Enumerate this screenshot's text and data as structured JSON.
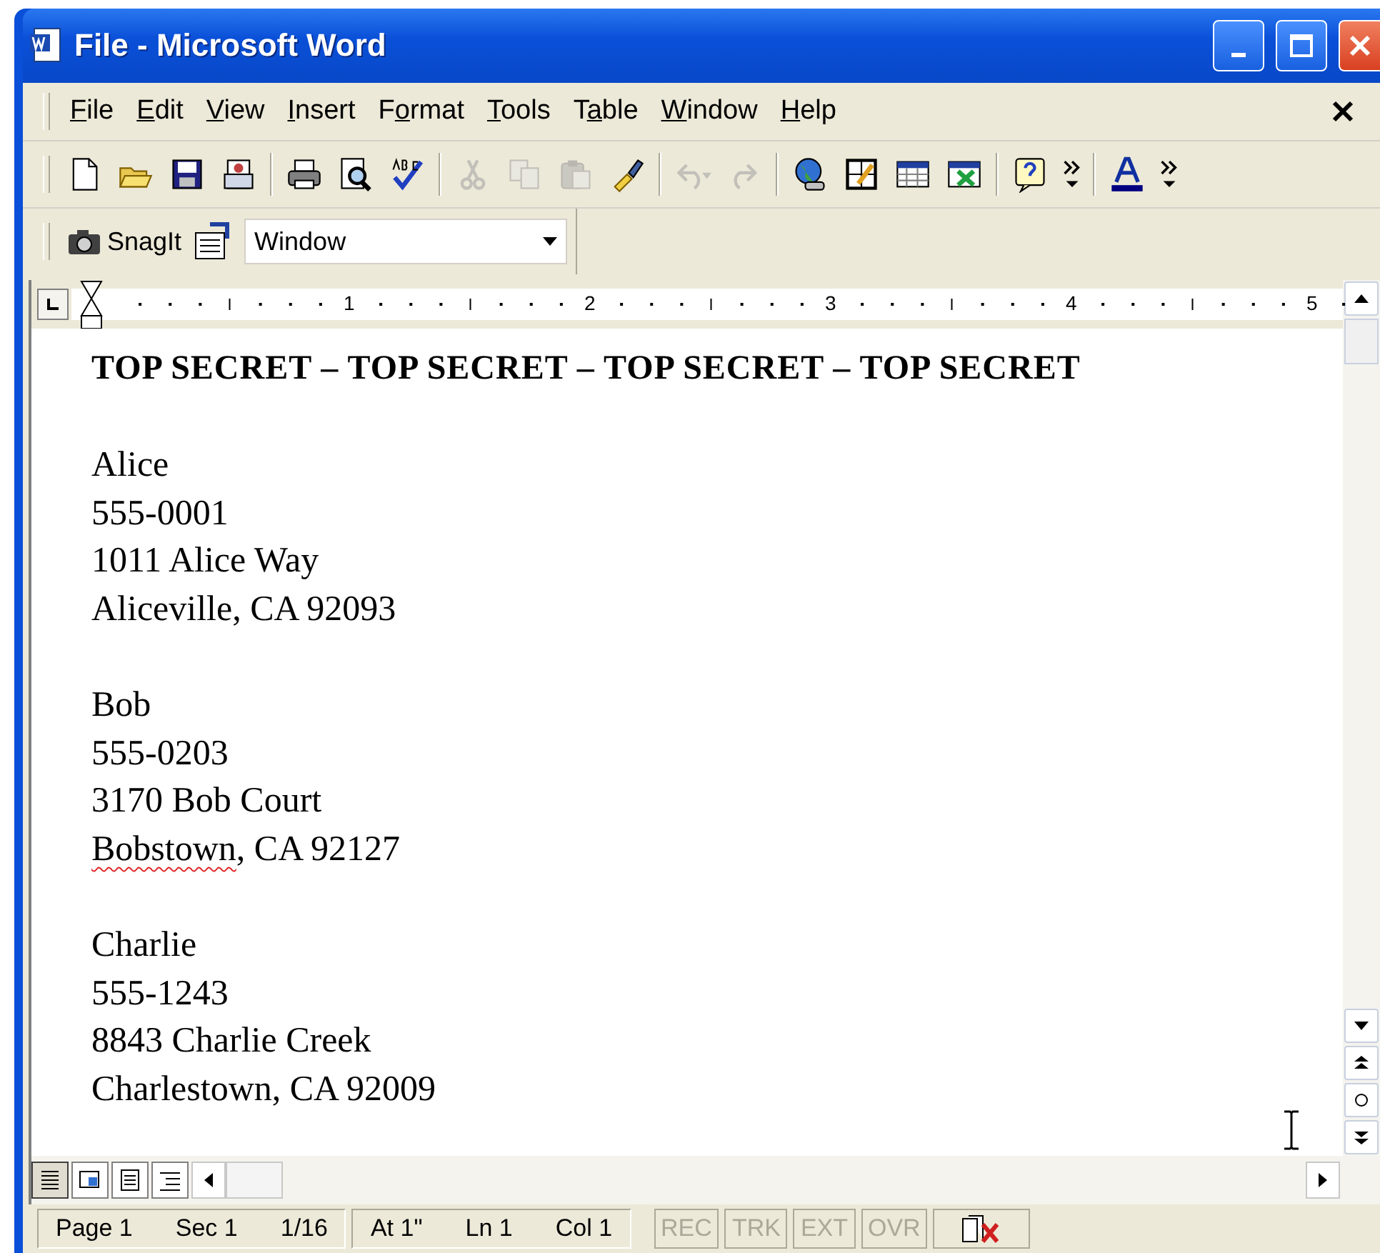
{
  "window": {
    "title": "File - Microsoft Word"
  },
  "menu": [
    {
      "key": "F",
      "rest": "ile"
    },
    {
      "key": "E",
      "rest": "dit"
    },
    {
      "key": "V",
      "rest": "iew"
    },
    {
      "key": "I",
      "rest": "nsert"
    },
    {
      "pre": "F",
      "key": "o",
      "rest": "rmat"
    },
    {
      "key": "T",
      "rest": "ools"
    },
    {
      "pre": "T",
      "key": "a",
      "rest": "ble"
    },
    {
      "key": "W",
      "rest": "indow"
    },
    {
      "key": "H",
      "rest": "elp"
    }
  ],
  "toolbar": [
    {
      "kind": "new",
      "disabled": false
    },
    {
      "kind": "open",
      "disabled": false
    },
    {
      "kind": "save",
      "disabled": false
    },
    {
      "kind": "permission",
      "disabled": false
    },
    {
      "kind": "separator"
    },
    {
      "kind": "print",
      "disabled": false
    },
    {
      "kind": "preview",
      "disabled": false
    },
    {
      "kind": "spelling",
      "disabled": false
    },
    {
      "kind": "separator"
    },
    {
      "kind": "cut",
      "disabled": true
    },
    {
      "kind": "copy",
      "disabled": true
    },
    {
      "kind": "paste",
      "disabled": true
    },
    {
      "kind": "brush",
      "disabled": false
    },
    {
      "kind": "separator"
    },
    {
      "kind": "undo",
      "disabled": true
    },
    {
      "kind": "redo",
      "disabled": true
    },
    {
      "kind": "separator"
    },
    {
      "kind": "globe",
      "disabled": false
    },
    {
      "kind": "borders",
      "disabled": false
    },
    {
      "kind": "table",
      "disabled": false
    },
    {
      "kind": "sheet",
      "disabled": false
    },
    {
      "kind": "separator"
    },
    {
      "kind": "help",
      "disabled": false
    },
    {
      "kind": "overflow",
      "disabled": false
    },
    {
      "kind": "separator"
    },
    {
      "kind": "fontcolor",
      "disabled": false
    },
    {
      "kind": "overflow",
      "disabled": false
    }
  ],
  "toolbar2": {
    "snagit": "SnagIt",
    "dropdown": {
      "value": "Window"
    }
  },
  "ruler": {
    "numbers": [
      "1",
      "2",
      "3",
      "4",
      "5"
    ]
  },
  "document": {
    "heading": "TOP SECRET – TOP SECRET – TOP SECRET – TOP SECRET",
    "blocks": [
      {
        "lines": [
          [
            {
              "text": "Alice",
              "misspelled": false
            }
          ],
          [
            {
              "text": "555-0001",
              "misspelled": false
            }
          ],
          [
            {
              "text": "1011 Alice Way",
              "misspelled": false
            }
          ],
          [
            {
              "text": "Aliceville, CA 92093",
              "misspelled": false
            }
          ]
        ]
      },
      {
        "lines": [
          [
            {
              "text": "Bob",
              "misspelled": false
            }
          ],
          [
            {
              "text": "555-0203",
              "misspelled": false
            }
          ],
          [
            {
              "text": "3170 Bob Court",
              "misspelled": false
            }
          ],
          [
            {
              "text": "Bobstown",
              "misspelled": true
            },
            {
              "text": ", CA 92127",
              "misspelled": false
            }
          ]
        ]
      },
      {
        "lines": [
          [
            {
              "text": "Charlie",
              "misspelled": false
            }
          ],
          [
            {
              "text": "555-1243",
              "misspelled": false
            }
          ],
          [
            {
              "text": "8843 Charlie Creek",
              "misspelled": false
            }
          ],
          [
            {
              "text": "Charlestown, CA 92009",
              "misspelled": false
            }
          ]
        ]
      }
    ]
  },
  "view_buttons": [
    {
      "kind": "normal",
      "selected": true
    },
    {
      "kind": "web",
      "selected": false
    },
    {
      "kind": "print",
      "selected": false
    },
    {
      "kind": "outline",
      "selected": false
    }
  ],
  "status_bar": {
    "groups": [
      [
        "Page 1",
        "Sec 1",
        "1/16"
      ],
      [
        "At 1\"",
        "Ln 1",
        "Col 1"
      ]
    ],
    "indicators": [
      {
        "label": "REC",
        "disabled": true
      },
      {
        "label": "TRK",
        "disabled": true
      },
      {
        "label": "EXT",
        "disabled": true
      },
      {
        "label": "OVR",
        "disabled": true
      }
    ]
  }
}
